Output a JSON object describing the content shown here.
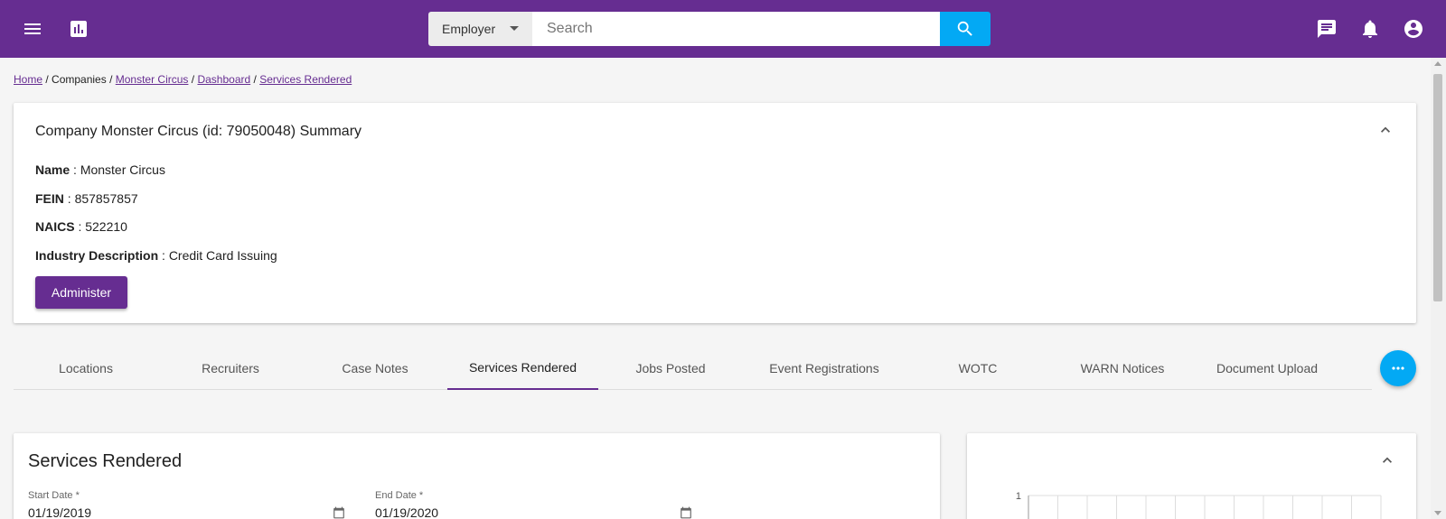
{
  "colors": {
    "brand": "#662d91",
    "accent": "#03a9f4"
  },
  "topbar": {
    "menu_icon": "menu-icon",
    "stats_icon": "bar-chart-icon",
    "search": {
      "category": "Employer",
      "placeholder": "Search",
      "value": ""
    },
    "right_icons": [
      "chat-icon",
      "bell-icon",
      "account-icon"
    ]
  },
  "breadcrumb": {
    "items": [
      {
        "label": "Home",
        "link": true
      },
      {
        "label": "Companies",
        "link": false
      },
      {
        "label": "Monster Circus",
        "link": true
      },
      {
        "label": "Dashboard",
        "link": true
      },
      {
        "label": "Services Rendered",
        "link": true
      }
    ],
    "separator": " / "
  },
  "summary": {
    "title": "Company Monster Circus (id: 79050048) Summary",
    "fields": [
      {
        "label": "Name",
        "value": "Monster Circus"
      },
      {
        "label": "FEIN",
        "value": "857857857"
      },
      {
        "label": "NAICS",
        "value": "522210"
      },
      {
        "label": "Industry Description",
        "value": "Credit Card Issuing"
      }
    ],
    "admin_button": "Administer"
  },
  "tabs": {
    "items": [
      "Locations",
      "Recruiters",
      "Case Notes",
      "Services Rendered",
      "Jobs Posted",
      "Event Registrations",
      "WOTC",
      "WARN Notices",
      "Document Upload"
    ],
    "active": "Services Rendered"
  },
  "services": {
    "title": "Services Rendered",
    "start_label": "Start Date *",
    "start_value": "01/19/2019",
    "end_label": "End Date *",
    "end_value": "01/19/2020"
  },
  "chart_data": {
    "type": "bar",
    "ytick_labels": [
      "1"
    ],
    "grid": true,
    "categories": [],
    "values": []
  }
}
